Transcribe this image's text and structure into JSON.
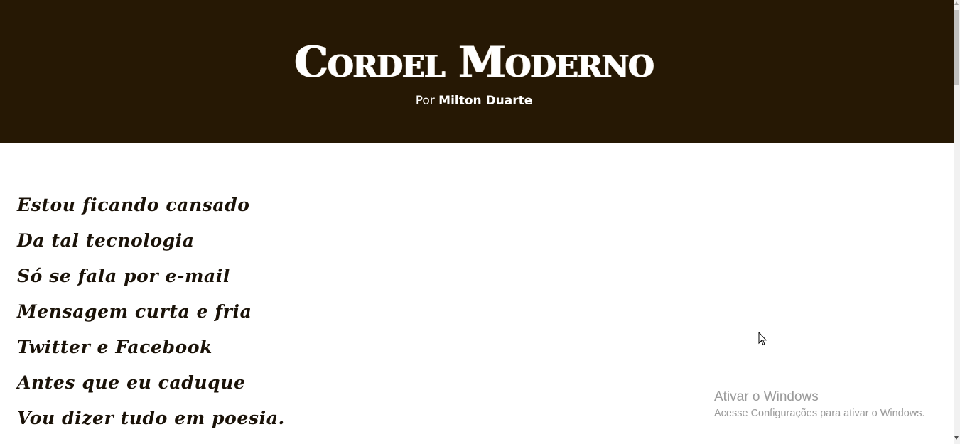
{
  "header": {
    "title": "Cordel Moderno",
    "byline_prefix": "Por",
    "byline_author": "Milton Duarte",
    "background_color": "#261804"
  },
  "poem": {
    "lines": [
      "Estou ficando cansado",
      "Da tal tecnologia",
      "Só se fala por e-mail",
      "Mensagem curta e fria",
      "Twitter e Facebook",
      "Antes que eu caduque",
      "Vou dizer tudo em poesia."
    ]
  },
  "watermark": {
    "title": "Ativar o Windows",
    "subtitle": "Acesse Configurações para ativar o Windows."
  },
  "icons": {
    "cursor": "arrow-cursor-icon"
  }
}
